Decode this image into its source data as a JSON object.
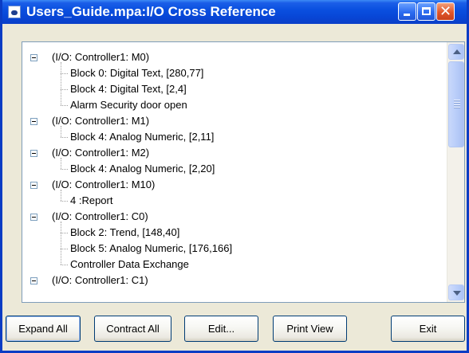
{
  "window": {
    "title": "Users_Guide.mpa:I/O Cross Reference",
    "icons": {
      "app": "application-icon",
      "minimize": "minimize-icon",
      "maximize": "maximize-icon",
      "close": "close-icon"
    },
    "colors": {
      "title_bar": "#0a50e0",
      "close_button": "#e0552a"
    }
  },
  "tree": {
    "nodes": [
      {
        "label": "(I/O: Controller1: M0)",
        "children": [
          "Block 0: Digital Text, [280,77]",
          "Block 4: Digital Text, [2,4]",
          "Alarm Security door open"
        ]
      },
      {
        "label": "(I/O: Controller1: M1)",
        "children": [
          "Block 4: Analog Numeric, [2,11]"
        ]
      },
      {
        "label": "(I/O: Controller1: M2)",
        "children": [
          "Block 4: Analog Numeric, [2,20]"
        ]
      },
      {
        "label": "(I/O: Controller1: M10)",
        "children": [
          "4 :Report"
        ]
      },
      {
        "label": "(I/O: Controller1: C0)",
        "children": [
          "Block 2: Trend, [148,40]",
          "Block 5: Analog Numeric, [176,166]",
          "Controller Data Exchange"
        ]
      },
      {
        "label": "(I/O: Controller1: C1)",
        "children": []
      }
    ]
  },
  "buttons": {
    "expand_all": "Expand All",
    "contract_all": "Contract All",
    "edit": "Edit...",
    "print_view": "Print View",
    "exit": "Exit"
  }
}
